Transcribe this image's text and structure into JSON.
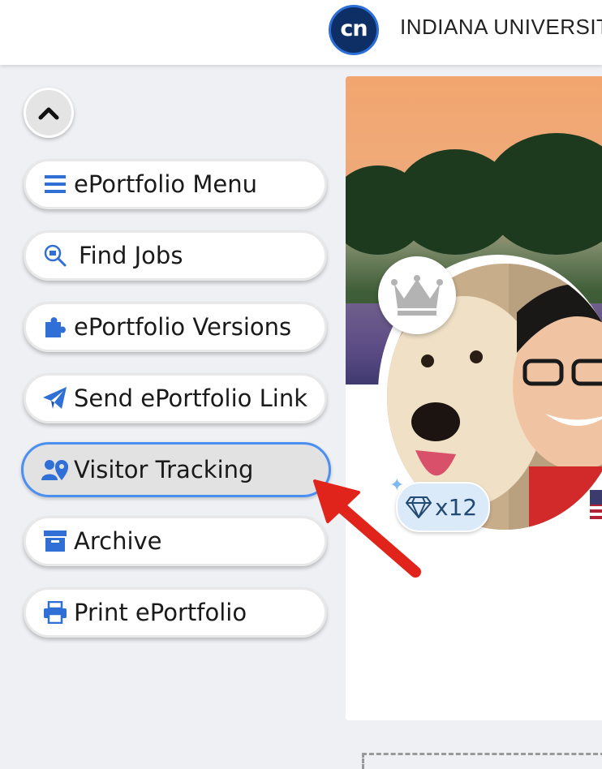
{
  "header": {
    "logo_text": "cn",
    "university_name": "INDIANA UNIVERSIT"
  },
  "sidebar": {
    "collapse_label": "",
    "items": [
      {
        "label": "ePortfolio Menu",
        "icon": "bars-icon"
      },
      {
        "label": "Find Jobs",
        "icon": "search-jobs-icon"
      },
      {
        "label": "ePortfolio Versions",
        "icon": "puzzle-icon"
      },
      {
        "label": "Send ePortfolio Link",
        "icon": "paper-plane-icon"
      },
      {
        "label": "Visitor Tracking",
        "icon": "user-location-icon",
        "active": true
      },
      {
        "label": "Archive",
        "icon": "archive-icon"
      },
      {
        "label": "Print ePortfolio",
        "icon": "printer-icon"
      }
    ]
  },
  "profile": {
    "gem_count": "x12"
  },
  "colors": {
    "accent": "#2f6fd6",
    "active_border": "#4b8ff0",
    "arrow": "#e0241b"
  }
}
